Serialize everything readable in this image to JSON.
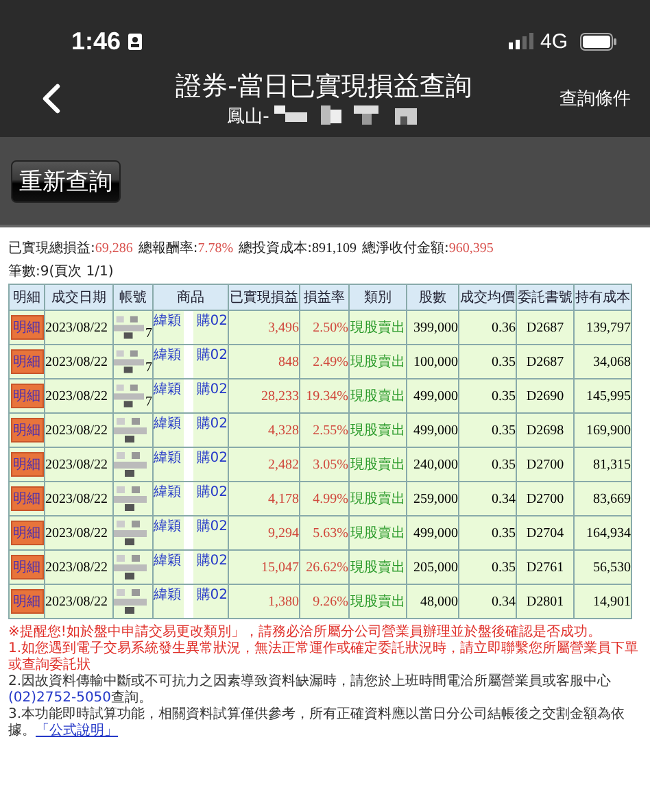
{
  "status_bar": {
    "time": "1:46",
    "network": "4G"
  },
  "header": {
    "title": "證券-當日已實現損益查詢",
    "subtitle": "鳳山-",
    "right_action": "查詢條件"
  },
  "requery_button": "重新查詢",
  "summary": [
    {
      "label": "已實現總損益:",
      "value": "69,286",
      "highlight": true
    },
    {
      "label": "總報酬率:",
      "value": "7.78%",
      "highlight": true
    },
    {
      "label": "總投資成本:",
      "value": "891,109",
      "highlight": false
    },
    {
      "label": "總淨收付金額:",
      "value": "960,395",
      "highlight": true
    }
  ],
  "count": "筆數:9(頁次 1/1)",
  "table": {
    "columns": [
      "明細",
      "成交日期",
      "帳號",
      "商品",
      "已實現損益",
      "損益率",
      "類別",
      "股數",
      "成交均價",
      "委託書號",
      "持有成本"
    ],
    "rows": [
      {
        "detail": "明細",
        "date": "2023/08/22",
        "account": "7",
        "product_start": "緯穎",
        "product_end": "購02",
        "realized": "3,496",
        "rate": "2.50%",
        "type": "現股賣出",
        "shares": "399,000",
        "avg_price": "0.36",
        "order_no": "D2687",
        "cost": "139,797"
      },
      {
        "detail": "明細",
        "date": "2023/08/22",
        "account": "7",
        "product_start": "緯穎",
        "product_end": "購02",
        "realized": "848",
        "rate": "2.49%",
        "type": "現股賣出",
        "shares": "100,000",
        "avg_price": "0.35",
        "order_no": "D2687",
        "cost": "34,068"
      },
      {
        "detail": "明細",
        "date": "2023/08/22",
        "account": "7",
        "product_start": "緯穎",
        "product_end": "購02",
        "realized": "28,233",
        "rate": "19.34%",
        "type": "現股賣出",
        "shares": "499,000",
        "avg_price": "0.35",
        "order_no": "D2690",
        "cost": "145,995"
      },
      {
        "detail": "明細",
        "date": "2023/08/22",
        "product_start": "緯穎",
        "product_end": "購02",
        "realized": "4,328",
        "rate": "2.55%",
        "type": "現股賣出",
        "shares": "499,000",
        "avg_price": "0.35",
        "order_no": "D2698",
        "cost": "169,900"
      },
      {
        "detail": "明細",
        "date": "2023/08/22",
        "product_start": "緯穎",
        "product_end": "購02",
        "realized": "2,482",
        "rate": "3.05%",
        "type": "現股賣出",
        "shares": "240,000",
        "avg_price": "0.35",
        "order_no": "D2700",
        "cost": "81,315"
      },
      {
        "detail": "明細",
        "date": "2023/08/22",
        "product_start": "緯穎",
        "product_end": "購02",
        "realized": "4,178",
        "rate": "4.99%",
        "type": "現股賣出",
        "shares": "259,000",
        "avg_price": "0.34",
        "order_no": "D2700",
        "cost": "83,669"
      },
      {
        "detail": "明細",
        "date": "2023/08/22",
        "product_start": "緯穎",
        "product_end": "購02",
        "realized": "9,294",
        "rate": "5.63%",
        "type": "現股賣出",
        "shares": "499,000",
        "avg_price": "0.35",
        "order_no": "D2704",
        "cost": "164,934"
      },
      {
        "detail": "明細",
        "date": "2023/08/22",
        "product_start": "緯穎",
        "product_end": "購02",
        "realized": "15,047",
        "rate": "26.62%",
        "type": "現股賣出",
        "shares": "205,000",
        "avg_price": "0.35",
        "order_no": "D2761",
        "cost": "56,530"
      },
      {
        "detail": "明細",
        "date": "2023/08/22",
        "product_start": "緯穎",
        "product_end": "購02",
        "realized": "1,380",
        "rate": "9.26%",
        "type": "現股賣出",
        "shares": "48,000",
        "avg_price": "0.34",
        "order_no": "D2801",
        "cost": "14,901"
      }
    ]
  },
  "notes": [
    {
      "kind": "warning",
      "parts": [
        {
          "kind": "plain",
          "text": "※提醒您!如於盤中申請交易更改類別」，請務必洽所屬分公司營業員辦理並於盤後確認是否成功。"
        }
      ]
    },
    {
      "kind": "warning",
      "parts": [
        {
          "kind": "plain",
          "text": "1.如您遇到電子交易系統發生異常狀況，無法正常運作或確定委託狀況時，請立即聯繫您所屬營業員下單或查詢委託狀"
        }
      ]
    },
    {
      "kind": "normal",
      "parts": [
        {
          "kind": "plain",
          "text": "2.因故資料傳輸中斷或不可抗力之因素導致資料缺漏時，請您於上班時間電洽所屬營業員或客服中心"
        },
        {
          "kind": "phone",
          "text": "(02)2752-5050"
        },
        {
          "kind": "plain",
          "text": "查詢。"
        }
      ]
    },
    {
      "kind": "normal",
      "parts": [
        {
          "kind": "plain",
          "text": "3.本功能即時試算功能，相關資料試算僅供參考，所有正確資料應以當日分公司結帳後之交割金額為依據。"
        },
        {
          "kind": "link",
          "text": "「公式說明」"
        }
      ]
    }
  ]
}
